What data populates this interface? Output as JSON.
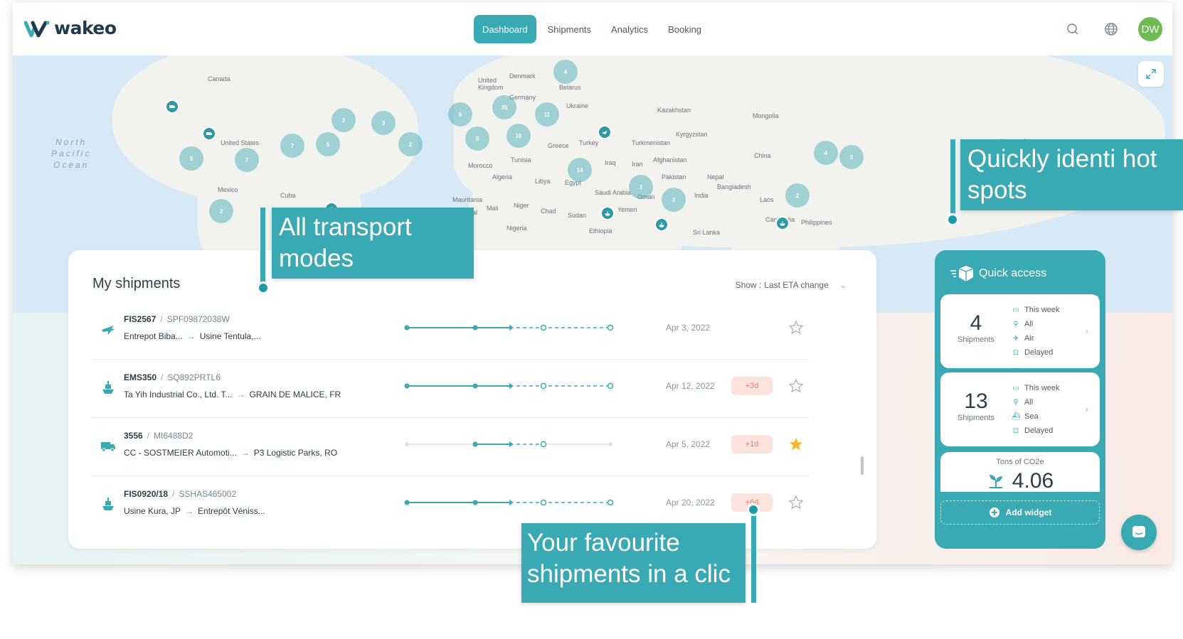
{
  "app": {
    "logo_text": "wakeo",
    "nav": [
      {
        "label": "Dashboard",
        "active": true
      },
      {
        "label": "Shipments",
        "active": false
      },
      {
        "label": "Analytics",
        "active": false
      },
      {
        "label": "Booking",
        "active": false
      }
    ],
    "avatar_initials": "DW"
  },
  "map": {
    "ocean_labels": [
      "North\nPacific\nOcean"
    ],
    "countries": [
      "Canada",
      "United States",
      "Mexico",
      "Cuba",
      "United Kingdom",
      "Denmark",
      "Belarus",
      "Germany",
      "Ukraine",
      "Kazakhstan",
      "Mongolia",
      "Kyrgyzstan",
      "Turkmenistan",
      "Greece",
      "Turkey",
      "China",
      "Tunisia",
      "Iraq",
      "Iran",
      "Afghanistan",
      "Morocco",
      "Algeria",
      "Libya",
      "Egypt",
      "Saudi Arabia",
      "Pakistan",
      "Nepal",
      "Bangladesh",
      "India",
      "Oman",
      "Mauritania",
      "Mali",
      "Niger",
      "Chad",
      "Sudan",
      "Yemen",
      "Nigeria",
      "Ethiopia",
      "Laos",
      "Cambodia",
      "Philippines",
      "Sri Lanka",
      "Senegal"
    ],
    "clusters": [
      "4",
      "35",
      "3",
      "3",
      "6",
      "11",
      "2",
      "5",
      "16",
      "7",
      "5",
      "7",
      "5",
      "14",
      "2",
      "3",
      "4",
      "2",
      "2",
      "2"
    ]
  },
  "shipments": {
    "title": "My shipments",
    "show_label": "Show :",
    "show_value": "Last ETA change",
    "rows": [
      {
        "mode": "air",
        "ref": "FIS2567",
        "ref2": "SPF09872038W",
        "from": "Entrepot Biba...",
        "to": "Usine Tentula,...",
        "date": "Apr 3, 2022",
        "delay": "",
        "favourite": false
      },
      {
        "mode": "sea",
        "ref": "EMS350",
        "ref2": "SQ892PRTL6",
        "from": "Ta Yih Industrial Co., Ltd. T...",
        "to": "GRAIN DE MALICE, FR",
        "date": "Apr 12, 2022",
        "delay": "+3d",
        "favourite": false
      },
      {
        "mode": "road",
        "ref": "3556",
        "ref2": "MI6488D2",
        "from": "CC - SOSTMEIER Automoti...",
        "to": "P3 Logistic Parks, RO",
        "date": "Apr 5, 2022",
        "delay": "+1d",
        "favourite": true
      },
      {
        "mode": "sea",
        "ref": "FIS0920/18",
        "ref2": "SSHAS465002",
        "from": "Usine Kura, JP",
        "to": "Entrepôt Véniss...",
        "date": "Apr 20, 2022",
        "delay": "+6d",
        "favourite": false
      }
    ]
  },
  "quick_access": {
    "title": "Quick access",
    "cards": [
      {
        "count": "4",
        "unit": "Shipments",
        "filters": [
          "This week",
          "All",
          "Air",
          "Delayed"
        ]
      },
      {
        "count": "13",
        "unit": "Shipments",
        "filters": [
          "This week",
          "All",
          "Sea",
          "Delayed"
        ]
      }
    ],
    "co2_label": "Tons of CO2e",
    "co2_value": "4.06",
    "add_widget": "Add widget"
  },
  "callouts": {
    "transport": "All transport modes",
    "hotspots": "Quickly identi hot spots",
    "favourites": "Your favourite shipments in a clic"
  },
  "colors": {
    "accent": "#39a9b3",
    "delay_bg": "#fde3dd",
    "delay_text": "#ee7b63",
    "star_active": "#f5b82e"
  }
}
